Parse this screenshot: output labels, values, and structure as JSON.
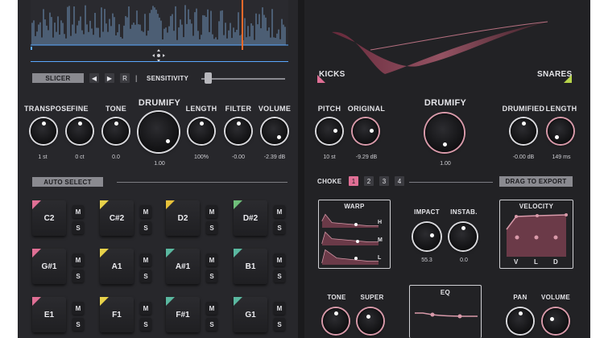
{
  "colors": {
    "accent_orange": "#ff6a2a",
    "accent_blue": "#5aa8ff",
    "accent_pink": "#e06f95",
    "panel": "#27272b"
  },
  "slicer": {
    "slicer_label": "SLICER",
    "prev_icon": "◀",
    "play_icon": "▶",
    "reset_label": "R",
    "separator": "|",
    "sensitivity_label": "SENSITIVITY"
  },
  "left_knobs": {
    "transpose": {
      "label": "TRANSPOSE",
      "value": "1 st"
    },
    "fine": {
      "label": "FINE",
      "value": "0 ct"
    },
    "tone": {
      "label": "TONE",
      "value": "0.0"
    },
    "drumify": {
      "label": "DRUMIFY",
      "value": "1.00"
    },
    "length": {
      "label": "LENGTH",
      "value": "100%"
    },
    "filter": {
      "label": "FILTER",
      "value": "-0.00"
    },
    "volume": {
      "label": "VOLUME",
      "value": "-2.39 dB"
    }
  },
  "auto_select": "AUTO SELECT",
  "pads": [
    {
      "note": "C2",
      "color": "#e06f95"
    },
    {
      "note": "C#2",
      "color": "#e8d24a"
    },
    {
      "note": "D2",
      "color": "#e8c23a"
    },
    {
      "note": "D#2",
      "color": "#6fbf7a"
    },
    {
      "note": "G#1",
      "color": "#e06f95"
    },
    {
      "note": "A1",
      "color": "#e8d24a"
    },
    {
      "note": "A#1",
      "color": "#5ab8a0"
    },
    {
      "note": "B1",
      "color": "#5ab8a0"
    },
    {
      "note": "E1",
      "color": "#e06f95"
    },
    {
      "note": "F1",
      "color": "#e8d24a"
    },
    {
      "note": "F#1",
      "color": "#5ab8a0"
    },
    {
      "note": "G1",
      "color": "#5ab8a0"
    }
  ],
  "mute_label": "M",
  "solo_label": "S",
  "right": {
    "kicks": "KICKS",
    "snares": "SNARES",
    "pitch": {
      "label": "PITCH",
      "value": "10 st"
    },
    "original": {
      "label": "ORIGINAL",
      "value": "-9.29 dB"
    },
    "drumify": {
      "label": "DRUMIFY",
      "value": "1.00"
    },
    "drumified": {
      "label": "DRUMIFIED",
      "value": "-0.00 dB"
    },
    "length": {
      "label": "LENGTH",
      "value": "149 ms"
    },
    "choke_label": "CHOKE",
    "choke_buttons": [
      "1",
      "2",
      "3",
      "4"
    ],
    "drag_export": "DRAG TO EXPORT",
    "warp": {
      "title": "WARP",
      "h": "H",
      "m": "M",
      "l": "L"
    },
    "impact": {
      "label": "IMPACT",
      "value": "55.3"
    },
    "instab": {
      "label": "INSTAB.",
      "value": "0.0"
    },
    "velocity": {
      "title": "VELOCITY",
      "v": "V",
      "l": "L",
      "d": "D"
    },
    "tone": {
      "label": "TONE"
    },
    "super": {
      "label": "SUPER"
    },
    "eq": {
      "title": "EQ"
    },
    "pan": {
      "label": "PAN"
    },
    "volume": {
      "label": "VOLUME"
    }
  }
}
